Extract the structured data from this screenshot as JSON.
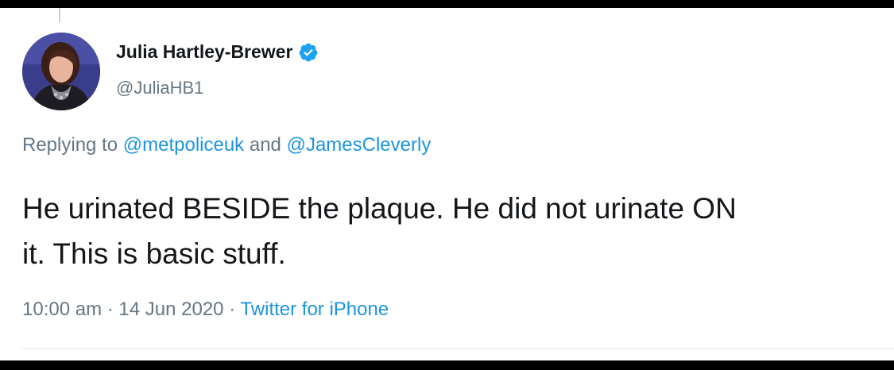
{
  "tweet": {
    "author": {
      "display_name": "Julia Hartley-Brewer",
      "handle": "@JuliaHB1",
      "verified_icon": "verified-badge-icon"
    },
    "reply": {
      "prefix": "Replying to ",
      "mention_1": "@metpoliceuk",
      "conjunction": " and ",
      "mention_2": "@JamesCleverly"
    },
    "text_line_1": "He urinated BESIDE the plaque. He did not urinate ON",
    "text_line_2": "it. This is basic stuff.",
    "meta": {
      "time": "10:00 am",
      "separator": " · ",
      "date": "14 Jun 2020",
      "source": "Twitter for iPhone"
    }
  },
  "colors": {
    "link": "#1b95e0",
    "secondary_text": "#657786",
    "primary_text": "#14171a",
    "verified": "#1da1f2"
  }
}
